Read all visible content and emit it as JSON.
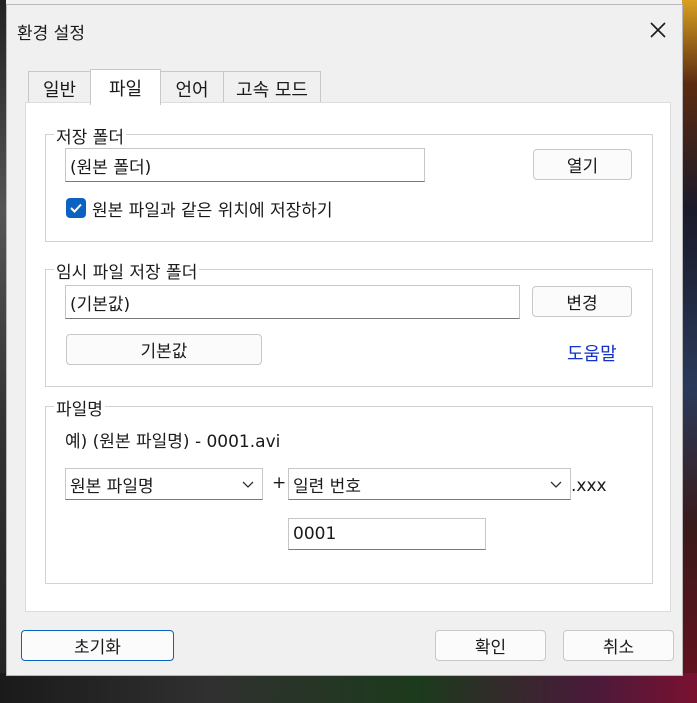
{
  "dialog": {
    "title": "환경 설정"
  },
  "tabs": [
    {
      "label": "일반"
    },
    {
      "label": "파일"
    },
    {
      "label": "언어"
    },
    {
      "label": "고속 모드"
    }
  ],
  "save_folder": {
    "legend": "저장 폴더",
    "path_value": "(원본 폴더)",
    "open_button": "열기",
    "same_location_checkbox": {
      "label": "원본 파일과 같은 위치에 저장하기",
      "checked": true
    }
  },
  "temp_folder": {
    "legend": "임시 파일 저장 폴더",
    "path_value": "(기본값)",
    "change_button": "변경",
    "default_button": "기본값",
    "help_link": "도움말"
  },
  "file_name": {
    "legend": "파일명",
    "example": "예) (원본 파일명) - 0001.avi",
    "first_select": "원본 파일명",
    "plus": "+",
    "second_select": "일련 번호",
    "extension": ".xxx",
    "number_value": "0001"
  },
  "footer": {
    "reset_button": "초기화",
    "ok_button": "확인",
    "cancel_button": "취소"
  },
  "colors": {
    "accent": "#0a62c2",
    "link": "#1330c8"
  },
  "icons": {
    "close": "close-icon",
    "check": "check-icon",
    "dropdown": "chevron-down-icon"
  }
}
